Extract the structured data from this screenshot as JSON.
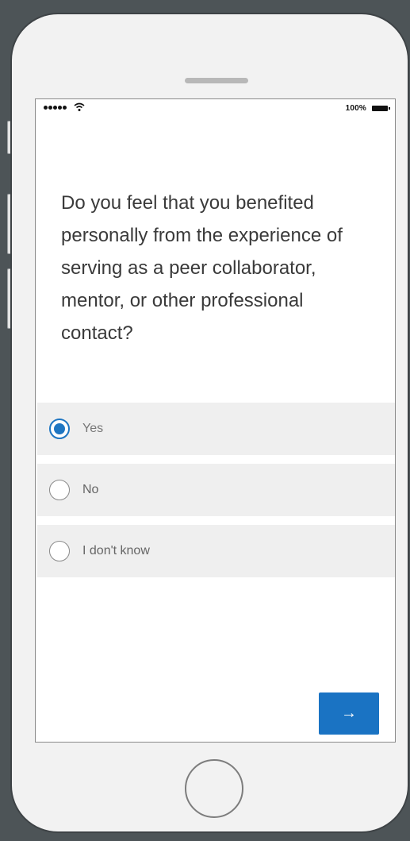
{
  "status_bar": {
    "battery_percent": "100%",
    "signal_icon": "signal-dots-icon",
    "wifi_icon": "wifi-icon",
    "battery_icon": "battery-icon"
  },
  "survey": {
    "question": "Do you feel that you benefited personally from the experience of serving as a peer collaborator, mentor, or other professional contact?",
    "options": [
      {
        "label": "Yes",
        "selected": true
      },
      {
        "label": "No",
        "selected": false
      },
      {
        "label": "I don't know",
        "selected": false
      }
    ],
    "next_icon": "→"
  },
  "colors": {
    "accent": "#1a73c3",
    "option_bg": "#efefef"
  }
}
